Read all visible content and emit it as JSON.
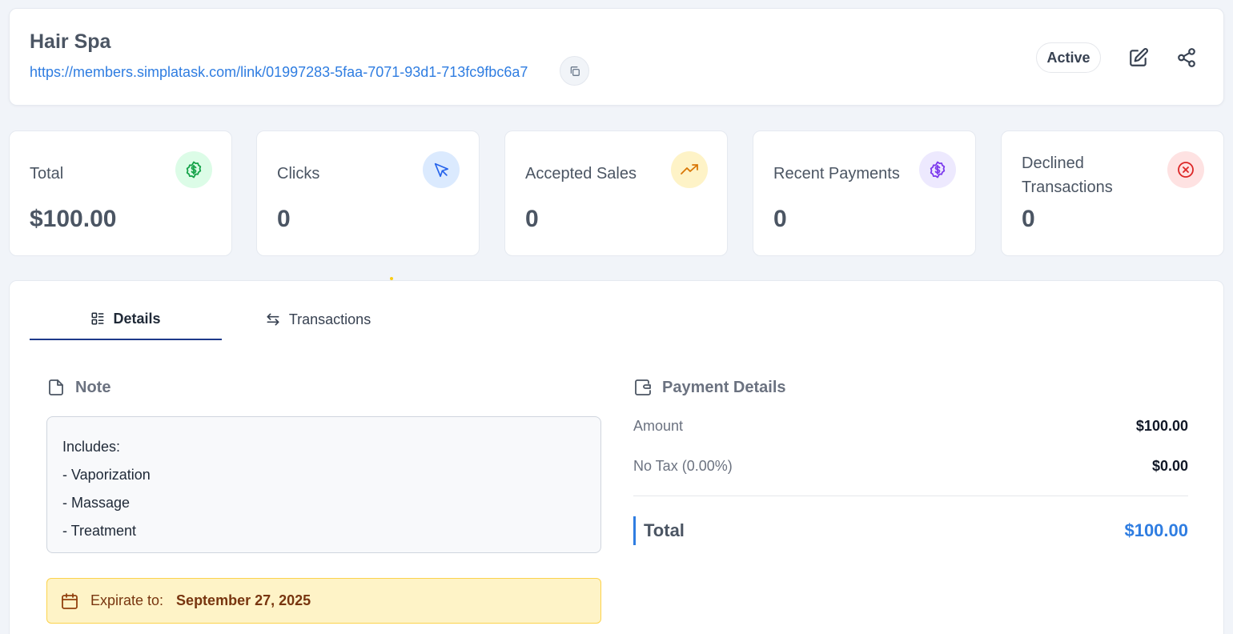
{
  "header": {
    "title": "Hair Spa",
    "link": "https://members.simplatask.com/link/01997283-5faa-7071-93d1-713fc9fbc6a7",
    "status": "Active"
  },
  "stats": [
    {
      "label": "Total",
      "value": "$100.00",
      "icon": "dollar-icon",
      "color": "#16a34a",
      "bg": "#dcfce7"
    },
    {
      "label": "Clicks",
      "value": "0",
      "icon": "cursor-icon",
      "color": "#2563eb",
      "bg": "#dbeafe"
    },
    {
      "label": "Accepted Sales",
      "value": "0",
      "icon": "trending-up-icon",
      "color": "#d97706",
      "bg": "#fef3c7"
    },
    {
      "label": "Recent Payments",
      "value": "0",
      "icon": "dollar-icon",
      "color": "#7c3aed",
      "bg": "#ede9fe"
    },
    {
      "label": "Declined Transactions",
      "value": "0",
      "icon": "x-circle-icon",
      "color": "#dc2626",
      "bg": "#fee2e2"
    }
  ],
  "tabs": [
    {
      "label": "Details",
      "active": true
    },
    {
      "label": "Transactions",
      "active": false
    }
  ],
  "note": {
    "title": "Note",
    "lines": [
      "Includes:",
      "- Vaporization",
      "- Massage",
      "- Treatment"
    ]
  },
  "expiration": {
    "label": "Expirate to:",
    "date": "September 27, 2025"
  },
  "payment": {
    "title": "Payment Details",
    "amount_label": "Amount",
    "amount_value": "$100.00",
    "tax_label": "No Tax (0.00%)",
    "tax_value": "$0.00",
    "total_label": "Total",
    "total_value": "$100.00"
  },
  "colors": {
    "accent": "#2f7de1",
    "tab_underline": "#1e3a8a"
  }
}
